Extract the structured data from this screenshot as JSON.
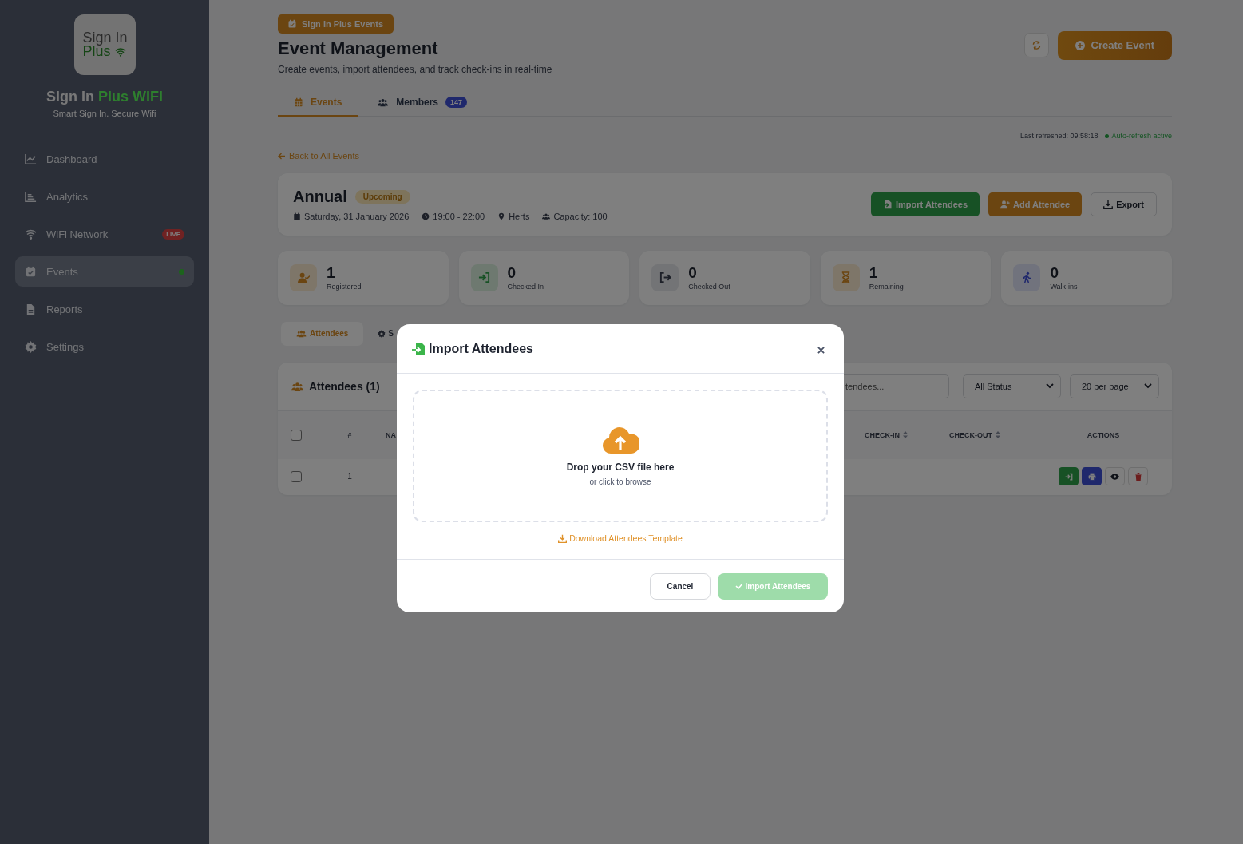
{
  "sidebar": {
    "logo": {
      "line_1": "Sign In",
      "line_2": "Plus"
    },
    "brand": {
      "primary": "Sign In",
      "accent": "Plus WiFi"
    },
    "tagline": "Smart Sign In. Secure Wifi",
    "items": [
      {
        "kind": "dashboard",
        "label": "Dashboard",
        "selected": false,
        "indicator": false
      },
      {
        "kind": "analytics",
        "label": "Analytics",
        "selected": false,
        "indicator": false
      },
      {
        "kind": "wifi",
        "label": "WiFi Network",
        "selected": false,
        "indicator": false,
        "badge": "LIVE"
      },
      {
        "kind": "events",
        "label": "Events",
        "selected": true,
        "indicator": true
      },
      {
        "kind": "reports",
        "label": "Reports",
        "selected": false,
        "indicator": false
      },
      {
        "kind": "settings",
        "label": "Settings",
        "selected": false,
        "indicator": false
      }
    ]
  },
  "header": {
    "badge": "Sign In Plus Events",
    "title": "Event Management",
    "subtitle": "Create events, import attendees, and track check-ins in real-time",
    "create_button": "Create Event"
  },
  "tabs": [
    {
      "kind": "events",
      "label": "Events",
      "selected": true
    },
    {
      "kind": "members",
      "label": "Members",
      "count": "147",
      "selected": false
    }
  ],
  "refresh": {
    "last_refreshed": "Last refreshed: 09:58:18",
    "auto_refresh": "Auto-refresh active"
  },
  "back_link": "Back to All Events",
  "event": {
    "name": "Annual",
    "status": "Upcoming",
    "meta": [
      {
        "kind": "date",
        "text": "Saturday, 31 January 2026"
      },
      {
        "kind": "time",
        "text": "19:00 - 22:00"
      },
      {
        "kind": "location",
        "text": "Herts"
      },
      {
        "kind": "capacity",
        "text": "Capacity: 100"
      }
    ],
    "actions": [
      {
        "kind": "import",
        "label": "Import Attendees"
      },
      {
        "kind": "add",
        "label": "Add Attendee"
      },
      {
        "kind": "export",
        "label": "Export"
      }
    ]
  },
  "stats": [
    {
      "kind": "registered",
      "value": "1",
      "label": "Registered"
    },
    {
      "kind": "checked_in",
      "value": "0",
      "label": "Checked In"
    },
    {
      "kind": "checked_out",
      "value": "0",
      "label": "Checked Out"
    },
    {
      "kind": "remaining",
      "value": "1",
      "label": "Remaining"
    },
    {
      "kind": "walk_ins",
      "value": "0",
      "label": "Walk-ins"
    }
  ],
  "sub_tabs": [
    {
      "kind": "attendees",
      "label": "Attendees",
      "selected": true
    },
    {
      "kind": "settings",
      "label": "S",
      "selected": false
    }
  ],
  "attendees": {
    "title": "Attendees (1)",
    "search": {
      "placeholder": "tendees..."
    },
    "filters": [
      "All Status",
      "20 per page"
    ],
    "select_all": {
      "checked": false
    },
    "columns": [
      {
        "label": "#"
      },
      {
        "label": "NA"
      },
      {
        "label": "CHECK-IN",
        "sortable": true
      },
      {
        "label": "CHECK-OUT",
        "sortable": true
      },
      {
        "label": "ACTIONS"
      }
    ],
    "rows": [
      {
        "checked": false,
        "number": "1",
        "check_in": "-",
        "check_out": "-"
      }
    ]
  },
  "modal": {
    "title": "Import Attendees",
    "drop_title": "Drop your CSV file here",
    "drop_hint": "or click to browse",
    "template_link": "Download Attendees Template",
    "cancel": "Cancel",
    "submit": {
      "label": "Import Attendees",
      "disabled": true
    }
  }
}
